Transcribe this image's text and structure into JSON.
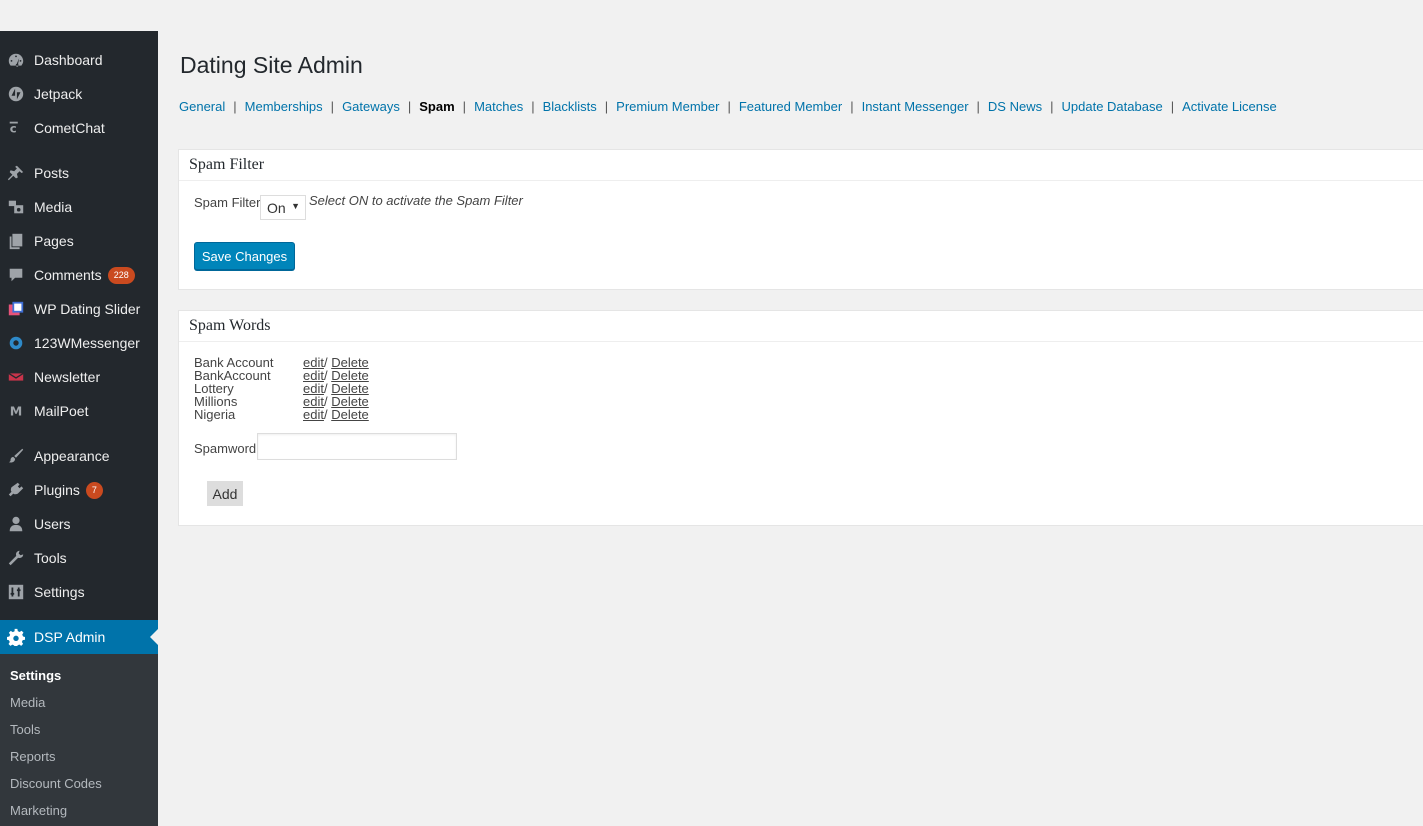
{
  "sidebar": {
    "items": [
      {
        "label": "Dashboard",
        "icon": "dashboard-icon"
      },
      {
        "label": "Jetpack",
        "icon": "jetpack-icon"
      },
      {
        "label": "CometChat",
        "icon": "cometchat-icon"
      },
      {
        "label": "Posts",
        "icon": "pin-icon"
      },
      {
        "label": "Media",
        "icon": "media-icon"
      },
      {
        "label": "Pages",
        "icon": "pages-icon"
      },
      {
        "label": "Comments",
        "icon": "comment-icon",
        "badge": "228"
      },
      {
        "label": "WP Dating Slider",
        "icon": "slider-icon"
      },
      {
        "label": "123WMessenger",
        "icon": "messenger-icon"
      },
      {
        "label": "Newsletter",
        "icon": "newsletter-icon"
      },
      {
        "label": "MailPoet",
        "icon": "mailpoet-icon"
      },
      {
        "label": "Appearance",
        "icon": "brush-icon"
      },
      {
        "label": "Plugins",
        "icon": "plugin-icon",
        "badge": "7"
      },
      {
        "label": "Users",
        "icon": "user-icon"
      },
      {
        "label": "Tools",
        "icon": "wrench-icon"
      },
      {
        "label": "Settings",
        "icon": "settings-icon"
      },
      {
        "label": "DSP Admin",
        "icon": "gear-icon",
        "active": true
      }
    ],
    "submenu": [
      "Settings",
      "Media",
      "Tools",
      "Reports",
      "Discount Codes",
      "Marketing"
    ]
  },
  "page_title": "Dating Site Admin",
  "subnav": {
    "items": [
      "General",
      "Memberships",
      "Gateways",
      "Spam",
      "Matches",
      "Blacklists",
      "Premium Member",
      "Featured Member",
      "Instant Messenger",
      "DS News",
      "Update Database",
      "Activate License"
    ],
    "separator": "|",
    "current": "Spam"
  },
  "spam_filter": {
    "title": "Spam Filter",
    "field_label": "Spam Filter",
    "selected": "On",
    "hint": "Select ON to activate the Spam Filter",
    "save_label": "Save Changes"
  },
  "spam_words": {
    "title": "Spam Words",
    "words": [
      "Bank Account",
      "BankAccount",
      "Lottery",
      "Millions",
      "Nigeria"
    ],
    "edit_label": "edit",
    "action_sep": "/ ",
    "delete_label": "Delete",
    "input_label": "Spamword",
    "input_value": "",
    "add_label": "Add"
  },
  "colors": {
    "sidebar_bg": "#23282d",
    "submenu_bg": "#32373c",
    "active_bg": "#0073aa",
    "link": "#0073aa",
    "badge": "#ca4a1f",
    "primary_button": "#0085ba"
  }
}
